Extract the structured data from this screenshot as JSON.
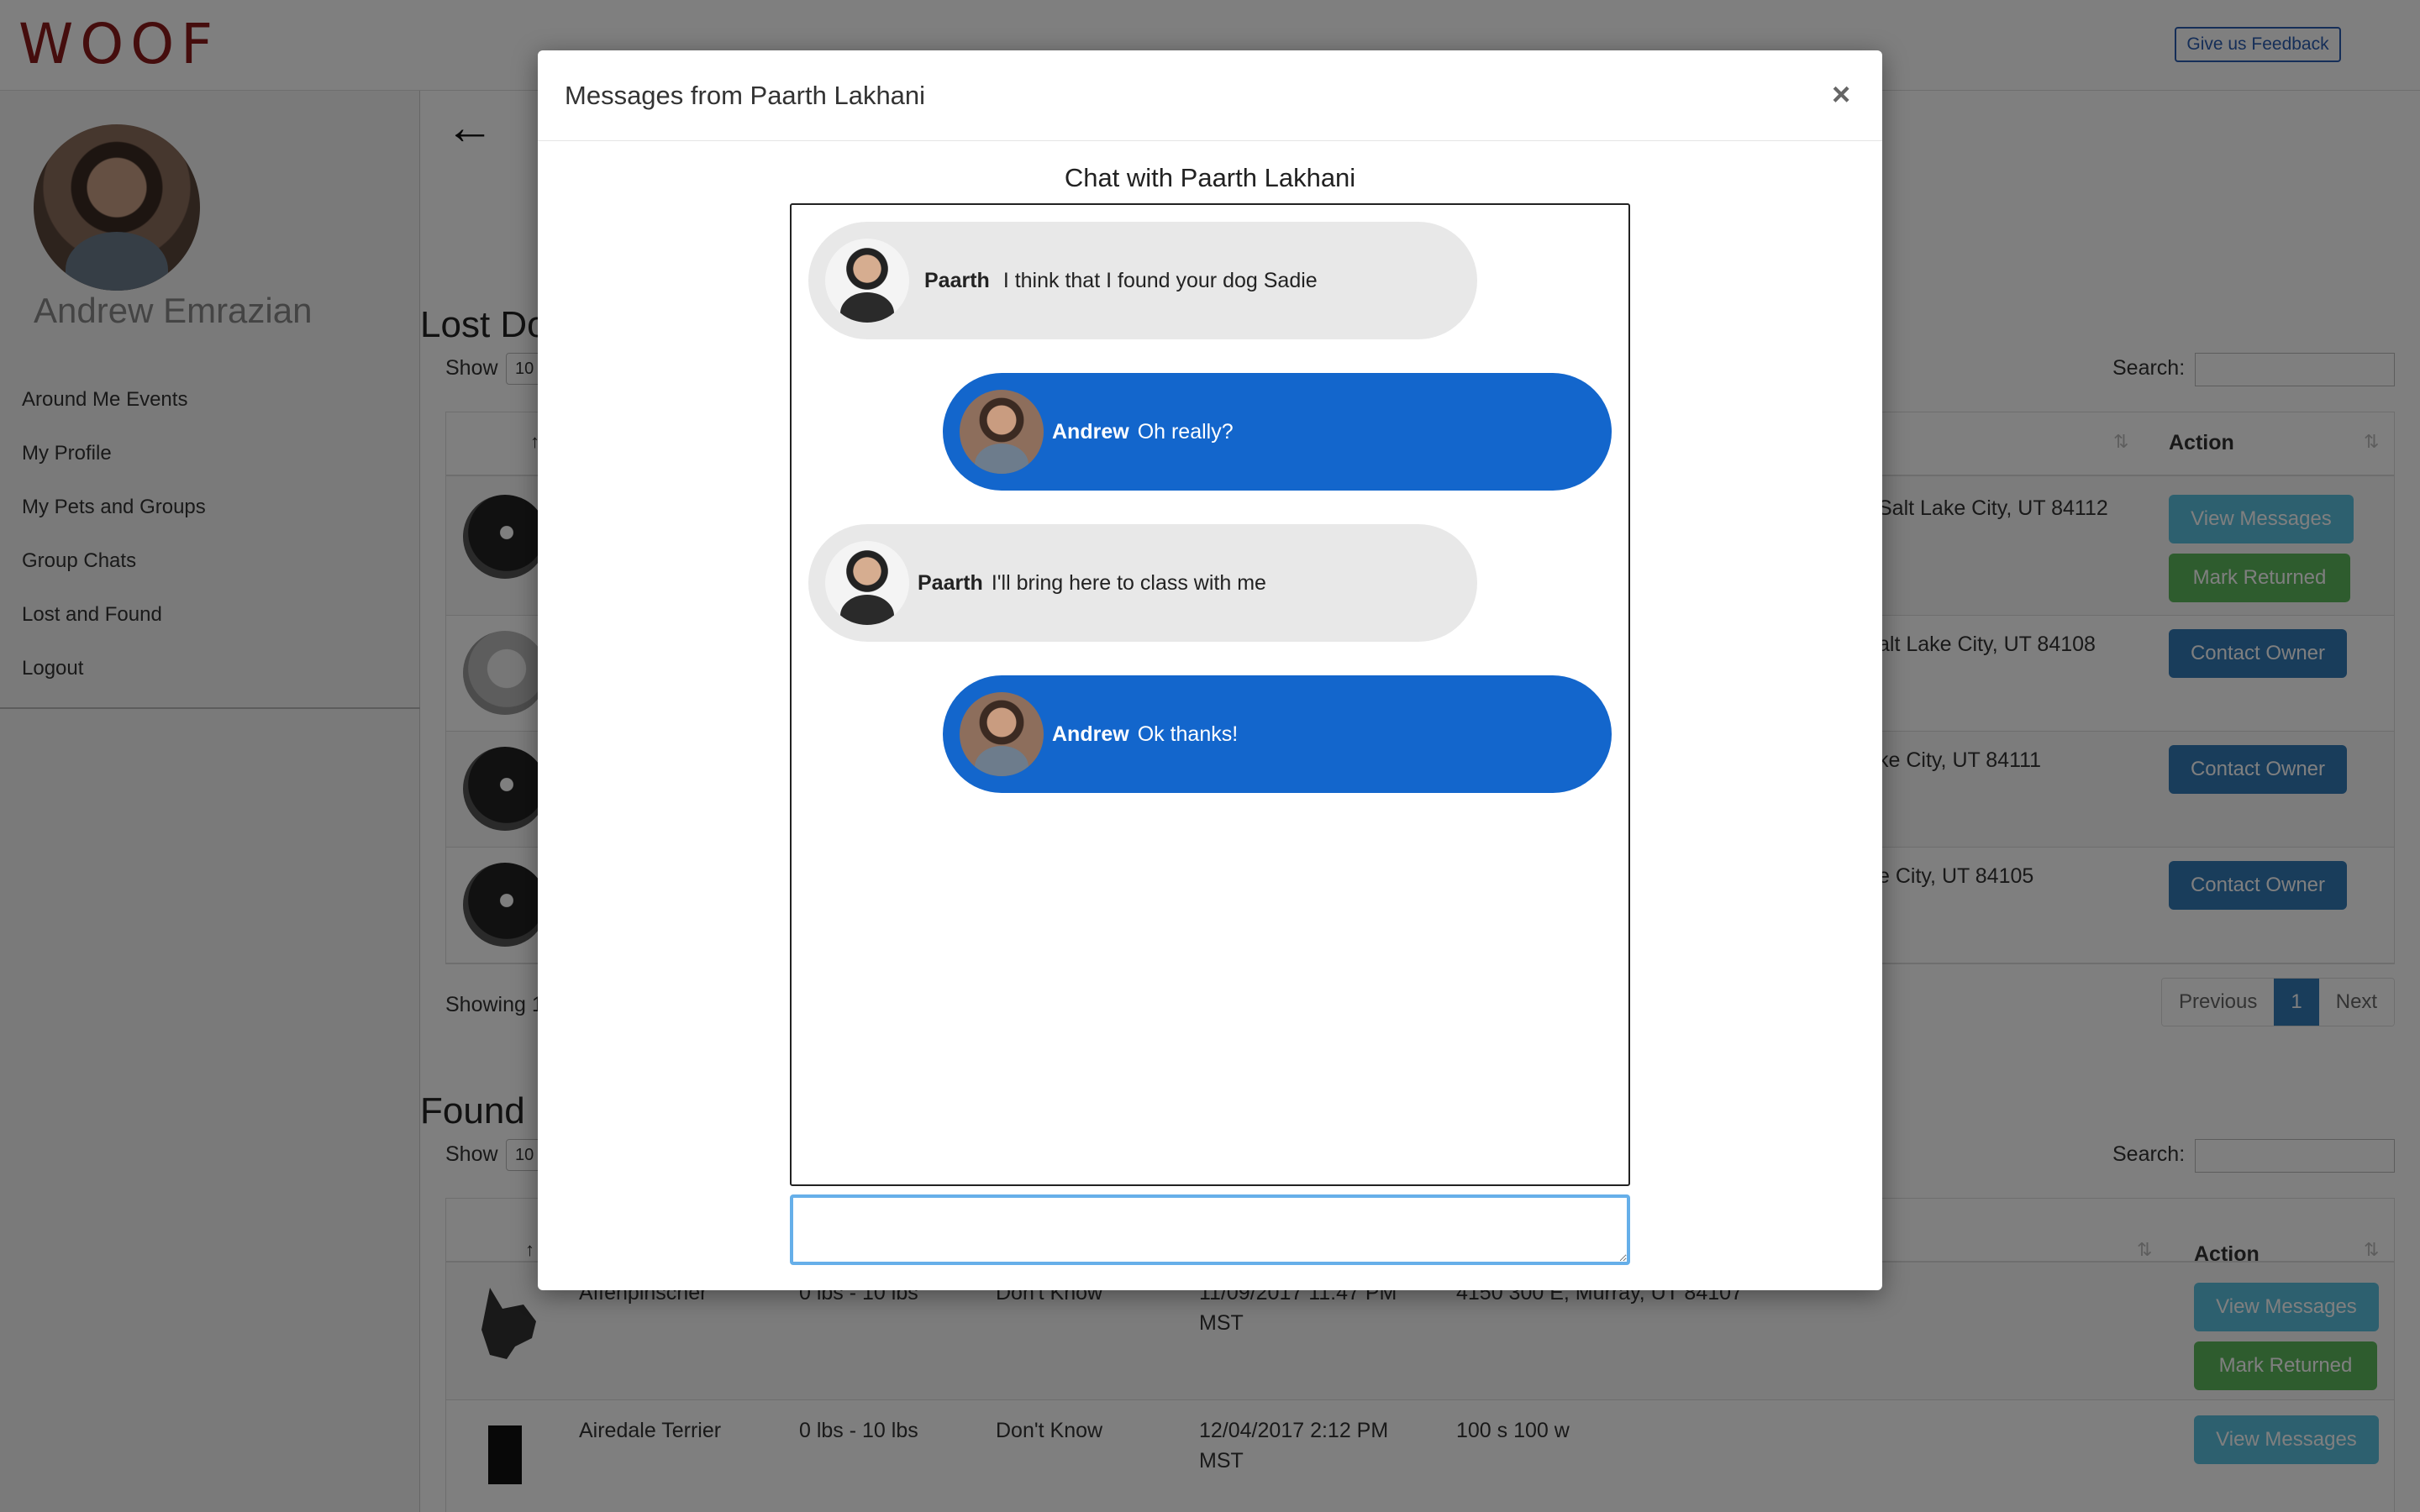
{
  "app": {
    "logo": "WOOF",
    "feedback_label": "Give us Feedback"
  },
  "sidebar": {
    "user_name": "Andrew Emrazian",
    "items": [
      {
        "label": "Around Me Events"
      },
      {
        "label": "My Profile"
      },
      {
        "label": "My Pets and Groups"
      },
      {
        "label": "Group Chats"
      },
      {
        "label": "Lost and Found"
      },
      {
        "label": "Logout"
      }
    ]
  },
  "lost": {
    "title": "Lost Do",
    "show_label": "Show",
    "show_value": "10",
    "search_label": "Search:",
    "action_header": "Action",
    "rows": [
      {
        "address": "Salt Lake City, UT 84112",
        "buttons": [
          "View Messages",
          "Mark Returned"
        ]
      },
      {
        "address": "alt Lake City, UT 84108",
        "buttons": [
          "Contact Owner"
        ]
      },
      {
        "address": "ke City, UT 84111",
        "buttons": [
          "Contact Owner"
        ]
      },
      {
        "address": "e City, UT 84105",
        "buttons": [
          "Contact Owner"
        ]
      }
    ],
    "showing": "Showing 1",
    "pager": {
      "previous": "Previous",
      "page": "1",
      "next": "Next"
    }
  },
  "found": {
    "title": "Found D",
    "show_label": "Show",
    "show_value": "10",
    "search_label": "Search:",
    "action_header": "Action",
    "rows": [
      {
        "breed": "Affenpinscher",
        "weight": "0 lbs - 10 lbs",
        "gender": "Don't Know",
        "date": "11/09/2017 11:47 PM",
        "tz": "MST",
        "address": "4150 300 E, Murray, UT 84107",
        "buttons": [
          "View Messages",
          "Mark Returned"
        ]
      },
      {
        "breed": "Airedale Terrier",
        "weight": "0 lbs - 10 lbs",
        "gender": "Don't Know",
        "date": "12/04/2017 2:12 PM",
        "tz": "MST",
        "address": "100 s 100 w",
        "buttons": [
          "View Messages"
        ]
      }
    ]
  },
  "modal": {
    "title": "Messages from Paarth Lakhani",
    "close": "×",
    "chat_title": "Chat with Paarth Lakhani",
    "messages": [
      {
        "sender": "Paarth",
        "text": "I think that I found your dog Sadie",
        "direction": "in"
      },
      {
        "sender": "Andrew",
        "text": "Oh really?",
        "direction": "out"
      },
      {
        "sender": "Paarth",
        "text": "I'll bring here to class with me",
        "direction": "in"
      },
      {
        "sender": "Andrew",
        "text": "Ok thanks!",
        "direction": "out"
      }
    ],
    "input_value": ""
  },
  "colors": {
    "logo": "#8b1a1a",
    "outgoing_bubble": "#1366cc",
    "incoming_bubble": "#e8e8e8",
    "view_button": "#5bc0de",
    "mark_button": "#5cb85c",
    "contact_button": "#337ab7"
  }
}
